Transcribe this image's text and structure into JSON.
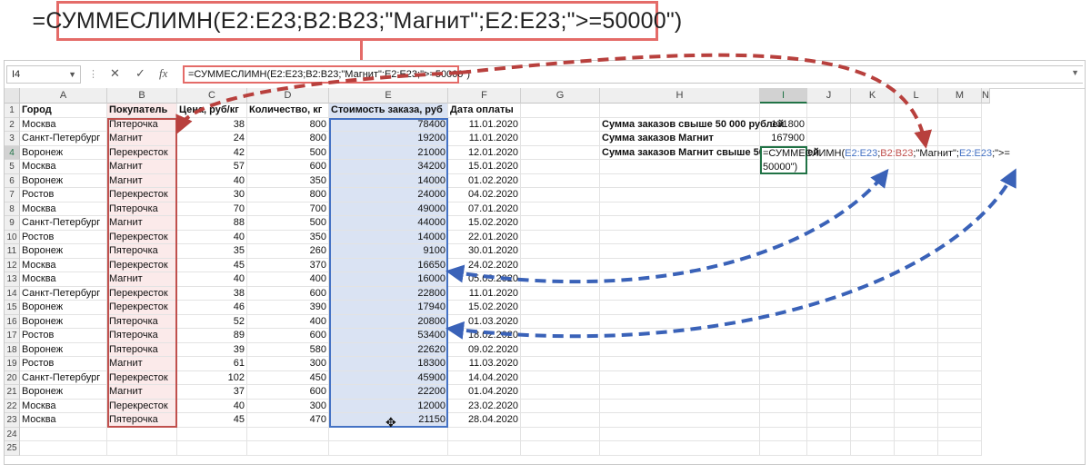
{
  "callout_formula": "=СУММЕСЛИМН(E2:E23;B2:B23;\"Магнит\";E2:E23;\">=50000\")",
  "name_box": "I4",
  "formula_bar": {
    "formula": "=СУММЕСЛИМН(E2:E23;B2:B23;\"Магнит\";E2:E23;\">=50000\")",
    "cancel_icon": "✕",
    "enter_icon": "✓",
    "fx_icon": "fx"
  },
  "columns": [
    "A",
    "B",
    "C",
    "D",
    "E",
    "F",
    "G",
    "H",
    "I",
    "J",
    "K",
    "L",
    "M",
    "N"
  ],
  "rows": [
    "1",
    "2",
    "3",
    "4",
    "5",
    "6",
    "7",
    "8",
    "9",
    "10",
    "11",
    "12",
    "13",
    "14",
    "15",
    "16",
    "17",
    "18",
    "19",
    "20",
    "21",
    "22",
    "23",
    "24",
    "25"
  ],
  "headers": {
    "city": "Город",
    "buyer": "Покупатель",
    "price": "Цена, руб/кг",
    "qty": "Количество, кг",
    "cost": "Стоимость заказа, руб",
    "date": "Дата оплаты"
  },
  "table": [
    {
      "city": "Москва",
      "buyer": "Пятерочка",
      "price": "38",
      "qty": "800",
      "cost": "78400",
      "date": "11.01.2020"
    },
    {
      "city": "Санкт-Петербург",
      "buyer": "Магнит",
      "price": "24",
      "qty": "800",
      "cost": "19200",
      "date": "11.01.2020"
    },
    {
      "city": "Воронеж",
      "buyer": "Перекресток",
      "price": "42",
      "qty": "500",
      "cost": "21000",
      "date": "12.01.2020"
    },
    {
      "city": "Москва",
      "buyer": "Магнит",
      "price": "57",
      "qty": "600",
      "cost": "34200",
      "date": "15.01.2020"
    },
    {
      "city": "Воронеж",
      "buyer": "Магнит",
      "price": "40",
      "qty": "350",
      "cost": "14000",
      "date": "01.02.2020"
    },
    {
      "city": "Ростов",
      "buyer": "Перекресток",
      "price": "30",
      "qty": "800",
      "cost": "24000",
      "date": "04.02.2020"
    },
    {
      "city": "Москва",
      "buyer": "Пятерочка",
      "price": "70",
      "qty": "700",
      "cost": "49000",
      "date": "07.01.2020"
    },
    {
      "city": "Санкт-Петербург",
      "buyer": "Магнит",
      "price": "88",
      "qty": "500",
      "cost": "44000",
      "date": "15.02.2020"
    },
    {
      "city": "Ростов",
      "buyer": "Перекресток",
      "price": "40",
      "qty": "350",
      "cost": "14000",
      "date": "22.01.2020"
    },
    {
      "city": "Воронеж",
      "buyer": "Пятерочка",
      "price": "35",
      "qty": "260",
      "cost": "9100",
      "date": "30.01.2020"
    },
    {
      "city": "Москва",
      "buyer": "Перекресток",
      "price": "45",
      "qty": "370",
      "cost": "16650",
      "date": "24.02.2020"
    },
    {
      "city": "Москва",
      "buyer": "Магнит",
      "price": "40",
      "qty": "400",
      "cost": "16000",
      "date": "05.03.2020"
    },
    {
      "city": "Санкт-Петербург",
      "buyer": "Перекресток",
      "price": "38",
      "qty": "600",
      "cost": "22800",
      "date": "11.01.2020"
    },
    {
      "city": "Воронеж",
      "buyer": "Перекресток",
      "price": "46",
      "qty": "390",
      "cost": "17940",
      "date": "15.02.2020"
    },
    {
      "city": "Воронеж",
      "buyer": "Пятерочка",
      "price": "52",
      "qty": "400",
      "cost": "20800",
      "date": "01.03.2020"
    },
    {
      "city": "Ростов",
      "buyer": "Пятерочка",
      "price": "89",
      "qty": "600",
      "cost": "53400",
      "date": "18.02.2020"
    },
    {
      "city": "Воронеж",
      "buyer": "Пятерочка",
      "price": "39",
      "qty": "580",
      "cost": "22620",
      "date": "09.02.2020"
    },
    {
      "city": "Ростов",
      "buyer": "Магнит",
      "price": "61",
      "qty": "300",
      "cost": "18300",
      "date": "11.03.2020"
    },
    {
      "city": "Санкт-Петербург",
      "buyer": "Перекресток",
      "price": "102",
      "qty": "450",
      "cost": "45900",
      "date": "14.04.2020"
    },
    {
      "city": "Воронеж",
      "buyer": "Магнит",
      "price": "37",
      "qty": "600",
      "cost": "22200",
      "date": "01.04.2020"
    },
    {
      "city": "Москва",
      "buyer": "Перекресток",
      "price": "40",
      "qty": "300",
      "cost": "12000",
      "date": "23.02.2020"
    },
    {
      "city": "Москва",
      "buyer": "Пятерочка",
      "price": "45",
      "qty": "470",
      "cost": "21150",
      "date": "28.04.2020"
    }
  ],
  "summary": [
    {
      "label": "Сумма заказов свыше 50 000 рублей",
      "value": "131800"
    },
    {
      "label": "Сумма заказов Магнит",
      "value": "167900"
    },
    {
      "label": "Сумма заказов Магнит свыше 50000 рублей",
      "value": ""
    }
  ],
  "edit_formula": {
    "p1": "=СУММЕСЛИМН(",
    "p2": "E2:E23",
    "p3": ";",
    "p4": "B2:B23",
    "p5": ";\"Магнит\";",
    "p6": "E2:E23",
    "p7": ";\">=",
    "p8": "50000\")"
  },
  "colors": {
    "accent_red": "#c0504d",
    "accent_blue": "#4472c4",
    "excel_green": "#217346"
  }
}
